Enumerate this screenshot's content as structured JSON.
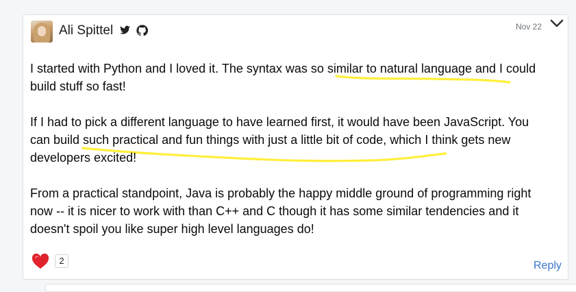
{
  "comment": {
    "author": "Ali Spittel",
    "date": "Nov 22",
    "paragraphs": [
      "I started with Python and I loved it. The syntax was so similar to natural language and I could build stuff so fast!",
      "If I had to pick a different language to have learned first, it would have been JavaScript. You can build such practical and fun things with just a little bit of code, which I think gets new developers excited!",
      "From a practical standpoint, Java is probably the happy middle ground of programming right now -- it is nicer to work with than C++ and C though it has some similar tendencies and it doesn't spoil you like super high level languages do!"
    ],
    "reactions": {
      "heart_count": "2"
    },
    "reply_label": "Reply"
  },
  "icons": {
    "twitter": "twitter-icon",
    "github": "github-icon",
    "heart": "heart-icon",
    "dropdown": "chevron-down-icon"
  },
  "colors": {
    "link": "#3b74c8",
    "highlight": "#ffef3a",
    "heart": "#e0232c"
  }
}
